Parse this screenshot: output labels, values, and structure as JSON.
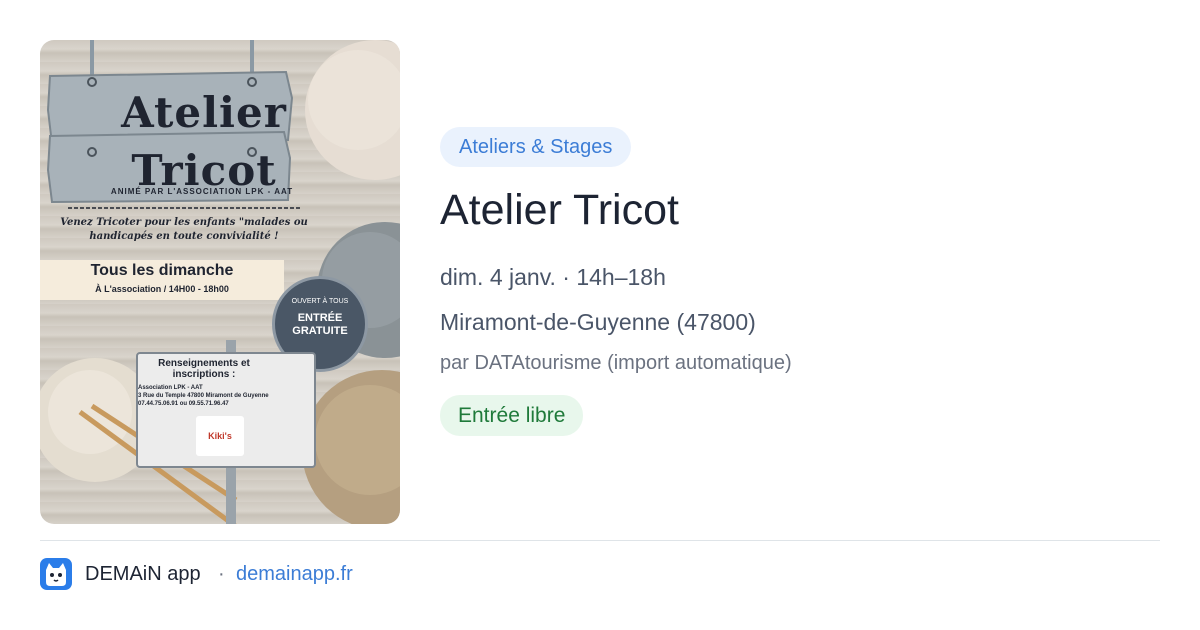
{
  "poster": {
    "line1": "Atelier",
    "line2": "Tricot",
    "anime": "ANIMÉ PAR L'ASSOCIATION LPK - AAT",
    "venez": "Venez Tricoter pour les enfants \"malades ou handicapés en toute convivialité !",
    "dimanche": "Tous les dimanche",
    "association_hours": "À L'association / 14H00 - 18h00",
    "ouvert": "OUVERT À TOUS",
    "entree": "ENTRÉE GRATUITE",
    "renseignements": "Renseignements et inscriptions :",
    "info_lines": [
      "Association LPK - AAT",
      "3 Rue du Temple 47800 Miramont de Guyenne",
      "07.44.75.06.91 ou 09.55.71.96.47"
    ],
    "logo_text": "Kiki's"
  },
  "event": {
    "category": "Ateliers & Stages",
    "title": "Atelier Tricot",
    "date": "dim. 4 janv. · 14h–18h",
    "location": "Miramont-de-Guyenne (47800)",
    "source": "par DATAtourisme (import automatique)",
    "price": "Entrée libre"
  },
  "footer": {
    "app_name": "DEMAiN app",
    "separator": "·",
    "link": "demainapp.fr",
    "app_icon": "cat-face-icon"
  },
  "colors": {
    "accent": "#3c7dd6",
    "chip_bg": "#eaf2fd",
    "price_bg": "#e8f7ec",
    "price_text": "#1f7a3a",
    "title": "#1d2433"
  }
}
